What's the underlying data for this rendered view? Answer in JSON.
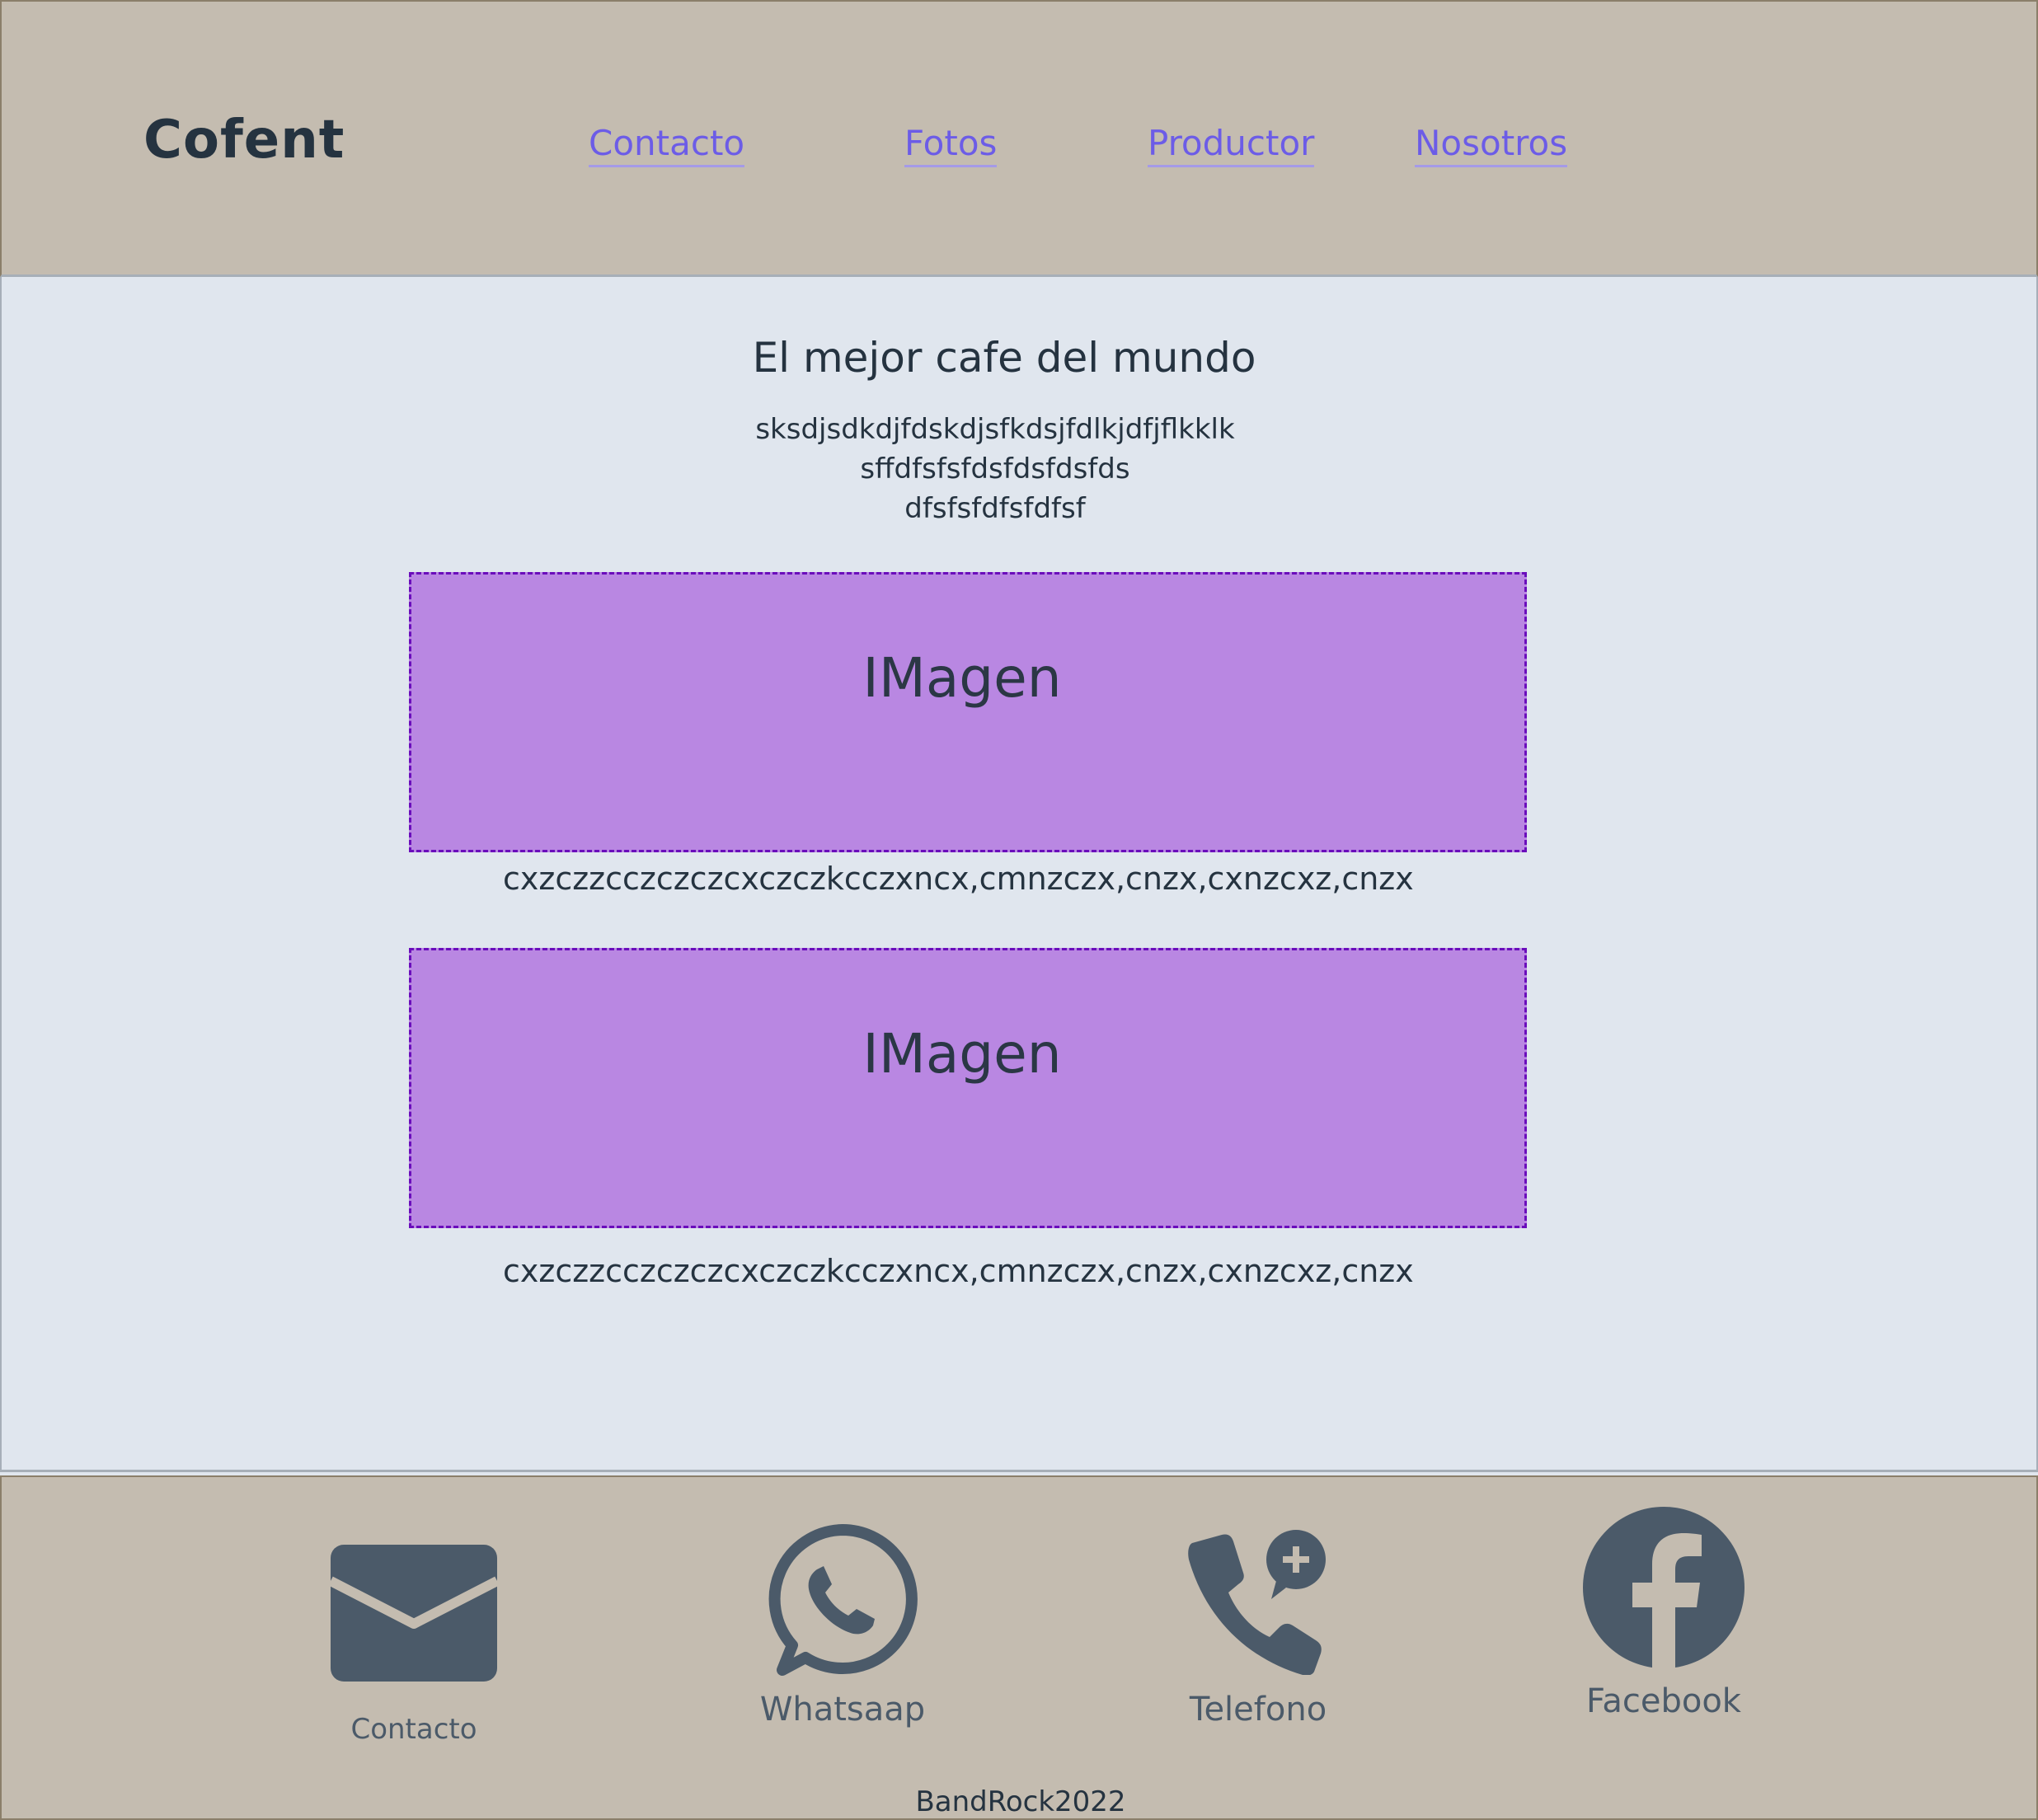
{
  "header": {
    "brand": "Cofent",
    "nav": [
      "Contacto",
      "Fotos",
      "Productor",
      "Nosotros"
    ]
  },
  "main": {
    "title": "El mejor cafe del mundo",
    "description_lines": [
      "sksdjsdkdjfdskdjsfkdsjfdlkjdfjflkklk",
      "sffdfsfsfdsfdsfdsfds",
      "dfsfsfdfsfdfsf"
    ],
    "cards": [
      {
        "image_label": "IMagen",
        "caption": "cxzczzcczczczcxczczkcczxncx,cmnzczx,cnzx,cxnzcxz,cnzx"
      },
      {
        "image_label": "IMagen",
        "caption": "cxzczzcczczczcxczczkcczxncx,cmnzczx,cnzx,cxnzcxz,cnzx"
      }
    ]
  },
  "footer": {
    "items": [
      {
        "icon": "envelope-icon",
        "label": "Contacto"
      },
      {
        "icon": "whatsapp-icon",
        "label": "Whatsaap"
      },
      {
        "icon": "phone-plus-icon",
        "label": "Telefono"
      },
      {
        "icon": "facebook-icon",
        "label": "Facebook"
      }
    ],
    "copyright": "BandRock2022"
  },
  "colors": {
    "header_bg": "#c4bcb0",
    "main_bg": "#e0e6ee",
    "link": "#6c5ce7",
    "image_placeholder": "#b987e2",
    "image_border": "#6a0dbb",
    "icon": "#4b5a69",
    "text": "#253340"
  }
}
